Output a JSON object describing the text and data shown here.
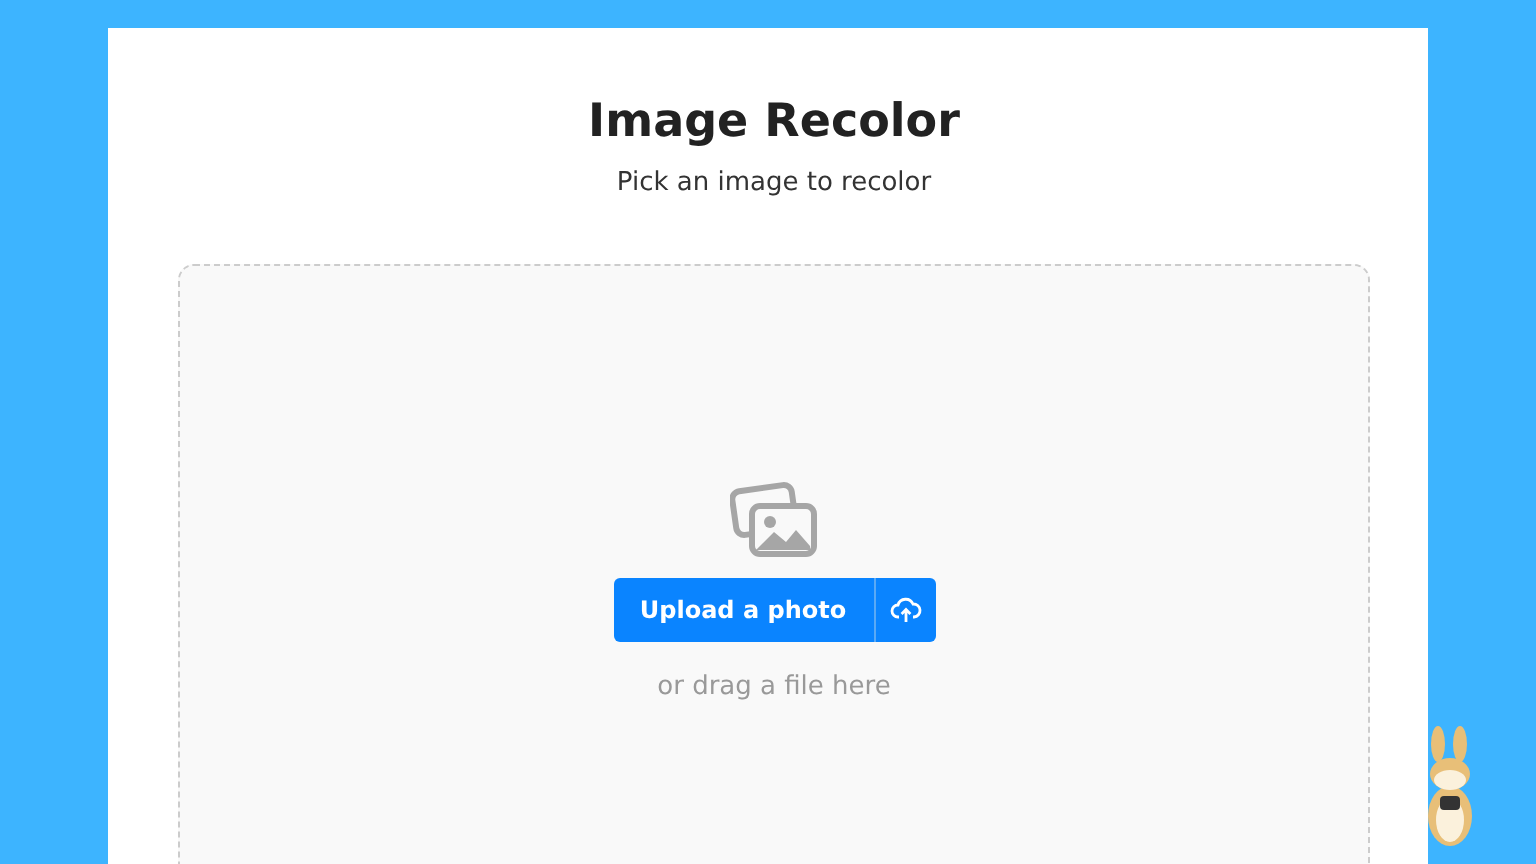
{
  "title": "Image Recolor",
  "subtitle": "Pick an image to recolor",
  "dropzone": {
    "button": "Upload a photo",
    "hint": "or drag a file here"
  }
}
